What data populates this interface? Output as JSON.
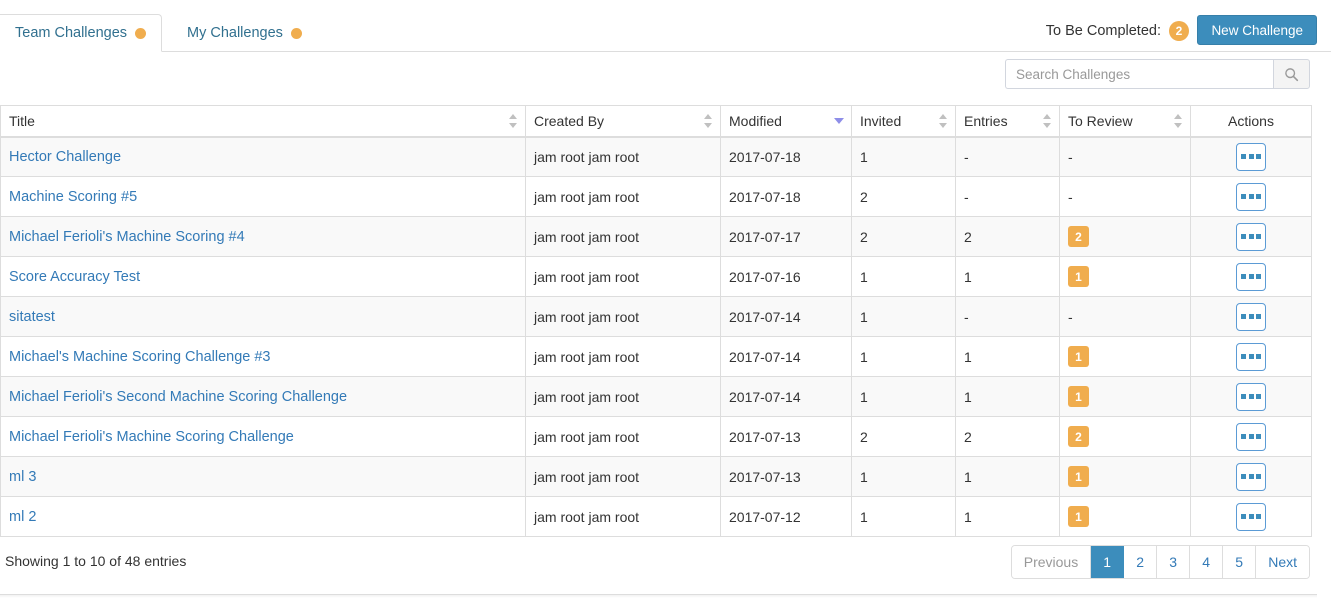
{
  "tabs": [
    {
      "label": "Team Challenges",
      "active": true,
      "dot": true,
      "dot_color": "#f0ad4e"
    },
    {
      "label": "My Challenges",
      "active": false,
      "dot": true,
      "dot_color": "#f0ad4e"
    }
  ],
  "header": {
    "to_be_completed_label": "To Be Completed:",
    "to_be_completed_count": "2",
    "new_challenge_label": "New Challenge",
    "accent_color": "#3c8dbc",
    "badge_color": "#f0ad4e"
  },
  "search": {
    "placeholder": "Search Challenges",
    "value": "",
    "icon": "search-icon"
  },
  "table": {
    "columns": [
      {
        "label": "Title",
        "sort": "both",
        "align": "left"
      },
      {
        "label": "Created By",
        "sort": "both",
        "align": "left"
      },
      {
        "label": "Modified",
        "sort": "desc",
        "align": "left"
      },
      {
        "label": "Invited",
        "sort": "both",
        "align": "left"
      },
      {
        "label": "Entries",
        "sort": "both",
        "align": "left"
      },
      {
        "label": "To Review",
        "sort": "both",
        "align": "left"
      },
      {
        "label": "Actions",
        "sort": "none",
        "align": "center"
      }
    ],
    "rows": [
      {
        "title": "Hector Challenge",
        "created_by": "jam root jam root",
        "modified": "2017-07-18",
        "invited": "1",
        "entries": "-",
        "to_review": "-",
        "to_review_badge": false,
        "action_icon": "ellipsis-icon"
      },
      {
        "title": "Machine Scoring #5",
        "created_by": "jam root jam root",
        "modified": "2017-07-18",
        "invited": "2",
        "entries": "-",
        "to_review": "-",
        "to_review_badge": false,
        "action_icon": "ellipsis-icon"
      },
      {
        "title": "Michael Ferioli's Machine Scoring #4",
        "created_by": "jam root jam root",
        "modified": "2017-07-17",
        "invited": "2",
        "entries": "2",
        "to_review": "2",
        "to_review_badge": true,
        "action_icon": "ellipsis-icon"
      },
      {
        "title": "Score Accuracy Test",
        "created_by": "jam root jam root",
        "modified": "2017-07-16",
        "invited": "1",
        "entries": "1",
        "to_review": "1",
        "to_review_badge": true,
        "action_icon": "ellipsis-icon"
      },
      {
        "title": "sitatest",
        "created_by": "jam root jam root",
        "modified": "2017-07-14",
        "invited": "1",
        "entries": "-",
        "to_review": "-",
        "to_review_badge": false,
        "action_icon": "ellipsis-icon"
      },
      {
        "title": "Michael's Machine Scoring Challenge #3",
        "created_by": "jam root jam root",
        "modified": "2017-07-14",
        "invited": "1",
        "entries": "1",
        "to_review": "1",
        "to_review_badge": true,
        "action_icon": "ellipsis-icon"
      },
      {
        "title": "Michael Ferioli's Second Machine Scoring Challenge",
        "created_by": "jam root jam root",
        "modified": "2017-07-14",
        "invited": "1",
        "entries": "1",
        "to_review": "1",
        "to_review_badge": true,
        "action_icon": "ellipsis-icon"
      },
      {
        "title": "Michael Ferioli's Machine Scoring Challenge",
        "created_by": "jam root jam root",
        "modified": "2017-07-13",
        "invited": "2",
        "entries": "2",
        "to_review": "2",
        "to_review_badge": true,
        "action_icon": "ellipsis-icon"
      },
      {
        "title": "ml 3",
        "created_by": "jam root jam root",
        "modified": "2017-07-13",
        "invited": "1",
        "entries": "1",
        "to_review": "1",
        "to_review_badge": true,
        "action_icon": "ellipsis-icon"
      },
      {
        "title": "ml 2",
        "created_by": "jam root jam root",
        "modified": "2017-07-12",
        "invited": "1",
        "entries": "1",
        "to_review": "1",
        "to_review_badge": true,
        "action_icon": "ellipsis-icon"
      }
    ]
  },
  "footer": {
    "info": "Showing 1 to 10 of 48 entries",
    "pagination": [
      {
        "label": "Previous",
        "state": "disabled"
      },
      {
        "label": "1",
        "state": "active"
      },
      {
        "label": "2",
        "state": "normal"
      },
      {
        "label": "3",
        "state": "normal"
      },
      {
        "label": "4",
        "state": "normal"
      },
      {
        "label": "5",
        "state": "normal"
      },
      {
        "label": "Next",
        "state": "normal"
      }
    ]
  }
}
